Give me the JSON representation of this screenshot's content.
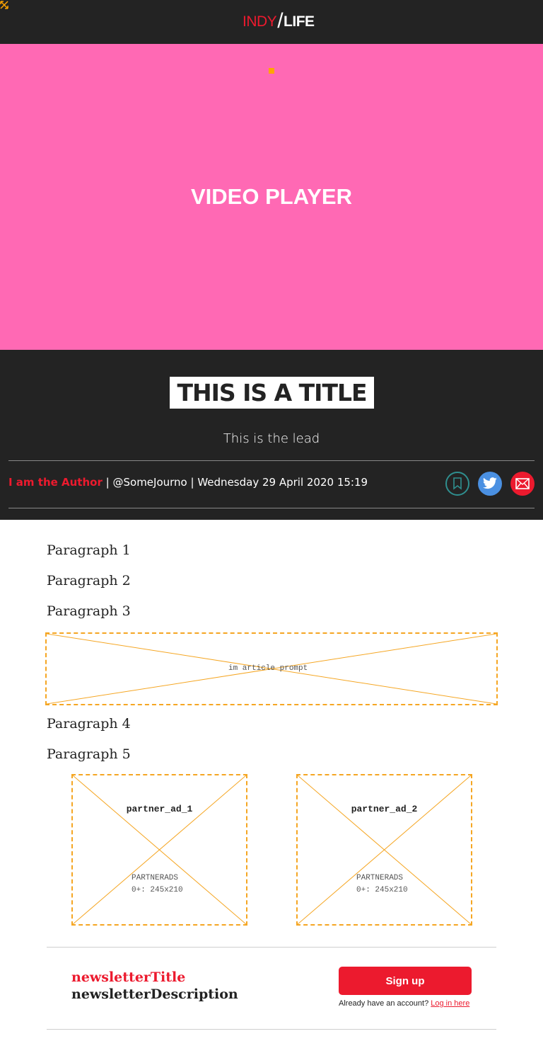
{
  "colors": {
    "topbar_bg": "#232323",
    "brand_red": "#ec1a2e",
    "video_bg": "#ff69b4",
    "ad_border": "#f5a623",
    "twitter_blue": "#4a90e2"
  },
  "brand": {
    "indy": "INDY",
    "slash": "/",
    "life": "LIFE"
  },
  "video": {
    "label": "VIDEO PLAYER"
  },
  "article": {
    "title": "THIS IS A TITLE",
    "lead": "This is the lead",
    "author": "I am the Author",
    "separator": "|",
    "handle": "@SomeJourno",
    "date": "Wednesday 29 April 2020 15:19"
  },
  "actions": {
    "bookmark_icon": "bookmark-icon",
    "twitter_icon": "twitter-icon",
    "mail_icon": "mail-icon"
  },
  "paragraphs": [
    "Paragraph 1",
    "Paragraph 2",
    "Paragraph 3",
    "Paragraph 4",
    "Paragraph 5"
  ],
  "ads": {
    "prompt": "im article prompt",
    "partners": [
      {
        "name": "partner_ad_1",
        "type": "PARTNERADS",
        "size": "0+: 245x210"
      },
      {
        "name": "partner_ad_2",
        "type": "PARTNERADS",
        "size": "0+: 245x210"
      }
    ]
  },
  "newsletter": {
    "title": "newsletterTitle",
    "description": "newsletterDescription",
    "signup_label": "Sign up",
    "login_prompt": "Already have an account?",
    "login_link": "Log in here"
  }
}
